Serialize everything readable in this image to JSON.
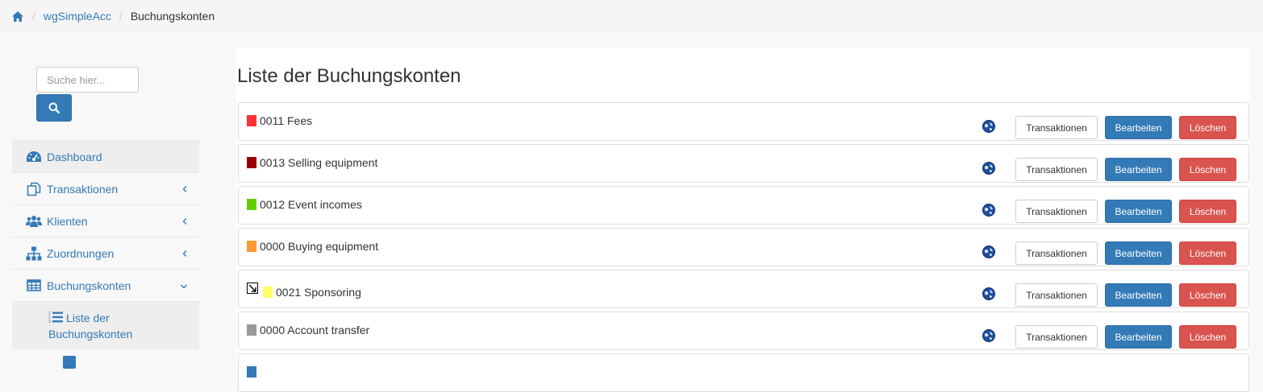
{
  "breadcrumb": {
    "home_icon": "home-icon",
    "app_link": "wgSimpleAcc",
    "current": "Buchungskonten"
  },
  "search": {
    "placeholder": "Suche hier...",
    "button_icon": "search-icon"
  },
  "nav": {
    "items": [
      {
        "label": "Dashboard",
        "icon": "dashboard-icon"
      },
      {
        "label": "Transaktionen",
        "icon": "copy-icon"
      },
      {
        "label": "Klienten",
        "icon": "users-icon"
      },
      {
        "label": "Zuordnungen",
        "icon": "sitemap-icon"
      },
      {
        "label": "Buchungskonten",
        "icon": "table-icon"
      }
    ],
    "sub_items": [
      {
        "label_line1": "Liste der",
        "label_line2": "Buchungskonten",
        "icon": "list-ol-icon"
      }
    ]
  },
  "main": {
    "title": "Liste der Buchungskonten",
    "buttons": {
      "transactions": "Transaktionen",
      "edit": "Bearbeiten",
      "delete": "Löschen"
    },
    "accounts": [
      {
        "name": "0011 Fees",
        "color": "#ff3333"
      },
      {
        "name": "0013 Selling equipment",
        "color": "#990000"
      },
      {
        "name": "0012 Event incomes",
        "color": "#66cc00"
      },
      {
        "name": "0000 Buying equipment",
        "color": "#ff9933"
      },
      {
        "name": "0021 Sponsoring",
        "color": "#ffff66"
      },
      {
        "name": "0000 Account transfer",
        "color": "#999999"
      }
    ]
  },
  "colors": {
    "link": "#337ab7",
    "primary": "#337ab7",
    "danger": "#d9534f"
  }
}
